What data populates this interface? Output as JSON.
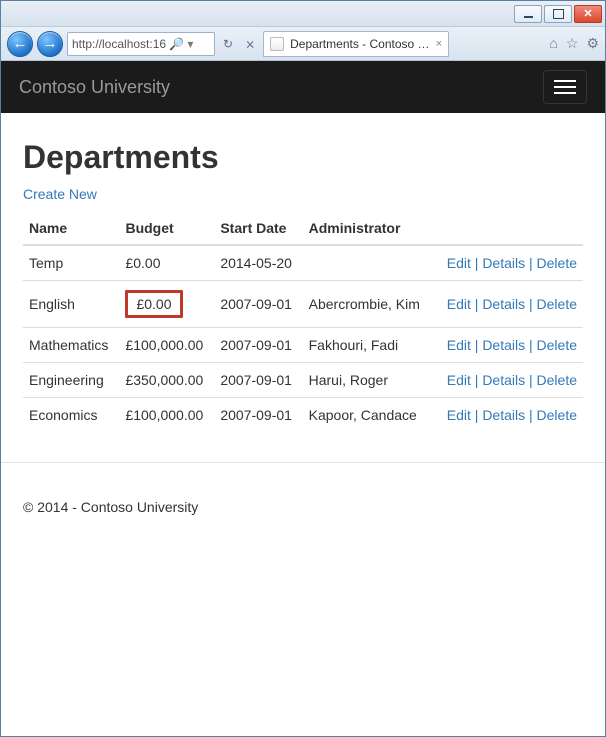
{
  "chrome": {
    "window_buttons": {
      "min": "min-icon",
      "max": "max-icon",
      "close_label": "✕"
    },
    "url_display": "http://localhost:16",
    "search_hint": "🔎 ▾",
    "refresh_icon": "↻",
    "stop_icon": "⨯",
    "tab_title": "Departments - Contoso Un...",
    "tab_close": "×",
    "right_icons": {
      "home": "⌂",
      "fav": "☆",
      "gear": "⚙"
    }
  },
  "navbar": {
    "brand": "Contoso University"
  },
  "page": {
    "heading": "Departments",
    "create_label": "Create New",
    "columns": {
      "name": "Name",
      "budget": "Budget",
      "start": "Start Date",
      "admin": "Administrator"
    },
    "action_labels": {
      "edit": "Edit",
      "details": "Details",
      "delete": "Delete",
      "sep": " | "
    },
    "rows": [
      {
        "name": "Temp",
        "budget": "£0.00",
        "start": "2014-05-20",
        "admin": "",
        "highlight": false
      },
      {
        "name": "English",
        "budget": "£0.00",
        "start": "2007-09-01",
        "admin": "Abercrombie, Kim",
        "highlight": true
      },
      {
        "name": "Mathematics",
        "budget": "£100,000.00",
        "start": "2007-09-01",
        "admin": "Fakhouri, Fadi",
        "highlight": false
      },
      {
        "name": "Engineering",
        "budget": "£350,000.00",
        "start": "2007-09-01",
        "admin": "Harui, Roger",
        "highlight": false
      },
      {
        "name": "Economics",
        "budget": "£100,000.00",
        "start": "2007-09-01",
        "admin": "Kapoor, Candace",
        "highlight": false
      }
    ]
  },
  "footer": {
    "text": "© 2014 - Contoso University"
  }
}
